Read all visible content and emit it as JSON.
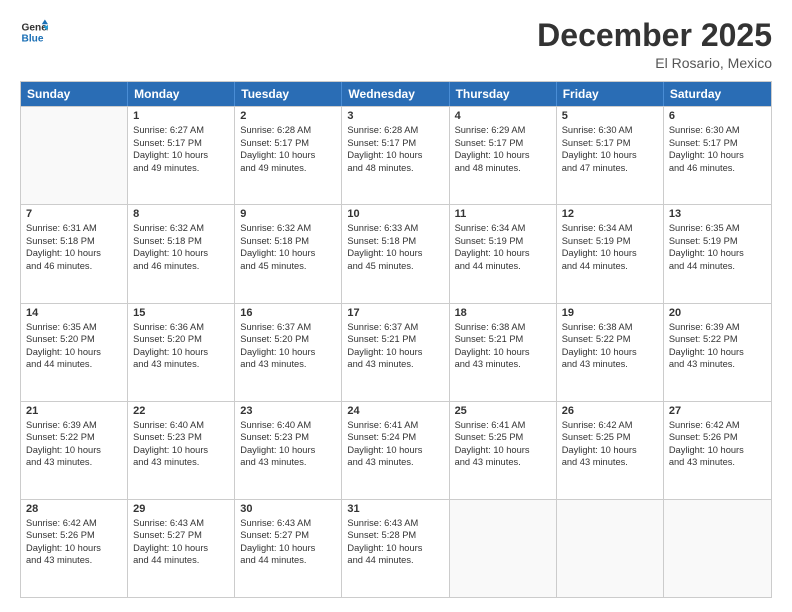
{
  "logo": {
    "line1": "General",
    "line2": "Blue"
  },
  "header": {
    "month": "December 2025",
    "location": "El Rosario, Mexico"
  },
  "weekdays": [
    "Sunday",
    "Monday",
    "Tuesday",
    "Wednesday",
    "Thursday",
    "Friday",
    "Saturday"
  ],
  "rows": [
    [
      {
        "day": "",
        "lines": []
      },
      {
        "day": "1",
        "lines": [
          "Sunrise: 6:27 AM",
          "Sunset: 5:17 PM",
          "Daylight: 10 hours",
          "and 49 minutes."
        ]
      },
      {
        "day": "2",
        "lines": [
          "Sunrise: 6:28 AM",
          "Sunset: 5:17 PM",
          "Daylight: 10 hours",
          "and 49 minutes."
        ]
      },
      {
        "day": "3",
        "lines": [
          "Sunrise: 6:28 AM",
          "Sunset: 5:17 PM",
          "Daylight: 10 hours",
          "and 48 minutes."
        ]
      },
      {
        "day": "4",
        "lines": [
          "Sunrise: 6:29 AM",
          "Sunset: 5:17 PM",
          "Daylight: 10 hours",
          "and 48 minutes."
        ]
      },
      {
        "day": "5",
        "lines": [
          "Sunrise: 6:30 AM",
          "Sunset: 5:17 PM",
          "Daylight: 10 hours",
          "and 47 minutes."
        ]
      },
      {
        "day": "6",
        "lines": [
          "Sunrise: 6:30 AM",
          "Sunset: 5:17 PM",
          "Daylight: 10 hours",
          "and 46 minutes."
        ]
      }
    ],
    [
      {
        "day": "7",
        "lines": [
          "Sunrise: 6:31 AM",
          "Sunset: 5:18 PM",
          "Daylight: 10 hours",
          "and 46 minutes."
        ]
      },
      {
        "day": "8",
        "lines": [
          "Sunrise: 6:32 AM",
          "Sunset: 5:18 PM",
          "Daylight: 10 hours",
          "and 46 minutes."
        ]
      },
      {
        "day": "9",
        "lines": [
          "Sunrise: 6:32 AM",
          "Sunset: 5:18 PM",
          "Daylight: 10 hours",
          "and 45 minutes."
        ]
      },
      {
        "day": "10",
        "lines": [
          "Sunrise: 6:33 AM",
          "Sunset: 5:18 PM",
          "Daylight: 10 hours",
          "and 45 minutes."
        ]
      },
      {
        "day": "11",
        "lines": [
          "Sunrise: 6:34 AM",
          "Sunset: 5:19 PM",
          "Daylight: 10 hours",
          "and 44 minutes."
        ]
      },
      {
        "day": "12",
        "lines": [
          "Sunrise: 6:34 AM",
          "Sunset: 5:19 PM",
          "Daylight: 10 hours",
          "and 44 minutes."
        ]
      },
      {
        "day": "13",
        "lines": [
          "Sunrise: 6:35 AM",
          "Sunset: 5:19 PM",
          "Daylight: 10 hours",
          "and 44 minutes."
        ]
      }
    ],
    [
      {
        "day": "14",
        "lines": [
          "Sunrise: 6:35 AM",
          "Sunset: 5:20 PM",
          "Daylight: 10 hours",
          "and 44 minutes."
        ]
      },
      {
        "day": "15",
        "lines": [
          "Sunrise: 6:36 AM",
          "Sunset: 5:20 PM",
          "Daylight: 10 hours",
          "and 43 minutes."
        ]
      },
      {
        "day": "16",
        "lines": [
          "Sunrise: 6:37 AM",
          "Sunset: 5:20 PM",
          "Daylight: 10 hours",
          "and 43 minutes."
        ]
      },
      {
        "day": "17",
        "lines": [
          "Sunrise: 6:37 AM",
          "Sunset: 5:21 PM",
          "Daylight: 10 hours",
          "and 43 minutes."
        ]
      },
      {
        "day": "18",
        "lines": [
          "Sunrise: 6:38 AM",
          "Sunset: 5:21 PM",
          "Daylight: 10 hours",
          "and 43 minutes."
        ]
      },
      {
        "day": "19",
        "lines": [
          "Sunrise: 6:38 AM",
          "Sunset: 5:22 PM",
          "Daylight: 10 hours",
          "and 43 minutes."
        ]
      },
      {
        "day": "20",
        "lines": [
          "Sunrise: 6:39 AM",
          "Sunset: 5:22 PM",
          "Daylight: 10 hours",
          "and 43 minutes."
        ]
      }
    ],
    [
      {
        "day": "21",
        "lines": [
          "Sunrise: 6:39 AM",
          "Sunset: 5:22 PM",
          "Daylight: 10 hours",
          "and 43 minutes."
        ]
      },
      {
        "day": "22",
        "lines": [
          "Sunrise: 6:40 AM",
          "Sunset: 5:23 PM",
          "Daylight: 10 hours",
          "and 43 minutes."
        ]
      },
      {
        "day": "23",
        "lines": [
          "Sunrise: 6:40 AM",
          "Sunset: 5:23 PM",
          "Daylight: 10 hours",
          "and 43 minutes."
        ]
      },
      {
        "day": "24",
        "lines": [
          "Sunrise: 6:41 AM",
          "Sunset: 5:24 PM",
          "Daylight: 10 hours",
          "and 43 minutes."
        ]
      },
      {
        "day": "25",
        "lines": [
          "Sunrise: 6:41 AM",
          "Sunset: 5:25 PM",
          "Daylight: 10 hours",
          "and 43 minutes."
        ]
      },
      {
        "day": "26",
        "lines": [
          "Sunrise: 6:42 AM",
          "Sunset: 5:25 PM",
          "Daylight: 10 hours",
          "and 43 minutes."
        ]
      },
      {
        "day": "27",
        "lines": [
          "Sunrise: 6:42 AM",
          "Sunset: 5:26 PM",
          "Daylight: 10 hours",
          "and 43 minutes."
        ]
      }
    ],
    [
      {
        "day": "28",
        "lines": [
          "Sunrise: 6:42 AM",
          "Sunset: 5:26 PM",
          "Daylight: 10 hours",
          "and 43 minutes."
        ]
      },
      {
        "day": "29",
        "lines": [
          "Sunrise: 6:43 AM",
          "Sunset: 5:27 PM",
          "Daylight: 10 hours",
          "and 44 minutes."
        ]
      },
      {
        "day": "30",
        "lines": [
          "Sunrise: 6:43 AM",
          "Sunset: 5:27 PM",
          "Daylight: 10 hours",
          "and 44 minutes."
        ]
      },
      {
        "day": "31",
        "lines": [
          "Sunrise: 6:43 AM",
          "Sunset: 5:28 PM",
          "Daylight: 10 hours",
          "and 44 minutes."
        ]
      },
      {
        "day": "",
        "lines": []
      },
      {
        "day": "",
        "lines": []
      },
      {
        "day": "",
        "lines": []
      }
    ]
  ]
}
